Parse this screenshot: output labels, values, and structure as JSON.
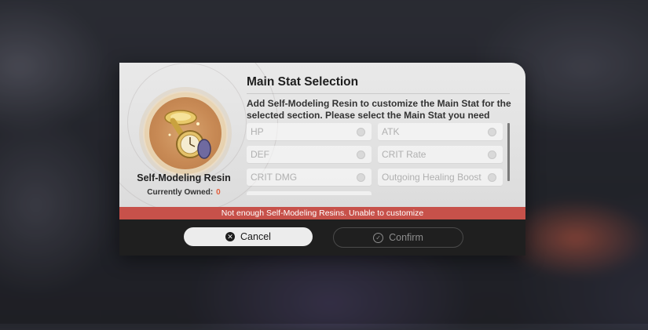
{
  "dialog": {
    "title": "Main Stat Selection",
    "description": "Add Self-Modeling Resin to customize the Main Stat for the selected section. Please select the Main Stat you need",
    "item": {
      "name": "Self-Modeling Resin",
      "owned_label": "Currently Owned:",
      "owned_count": "0",
      "icon": "resin-pocket-watch-icon"
    },
    "options": [
      {
        "label": "HP",
        "selected": false
      },
      {
        "label": "ATK",
        "selected": false
      },
      {
        "label": "DEF",
        "selected": false
      },
      {
        "label": "CRIT Rate",
        "selected": false
      },
      {
        "label": "CRIT DMG",
        "selected": false
      },
      {
        "label": "Outgoing Healing Boost",
        "selected": false
      }
    ],
    "warning": "Not enough Self-Modeling Resins. Unable to customize",
    "buttons": {
      "cancel": "Cancel",
      "confirm": "Confirm"
    }
  },
  "colors": {
    "warning_bg": "#c7514a",
    "owned_count": "#e35d3c",
    "footer_bg": "#1f1f1f"
  }
}
